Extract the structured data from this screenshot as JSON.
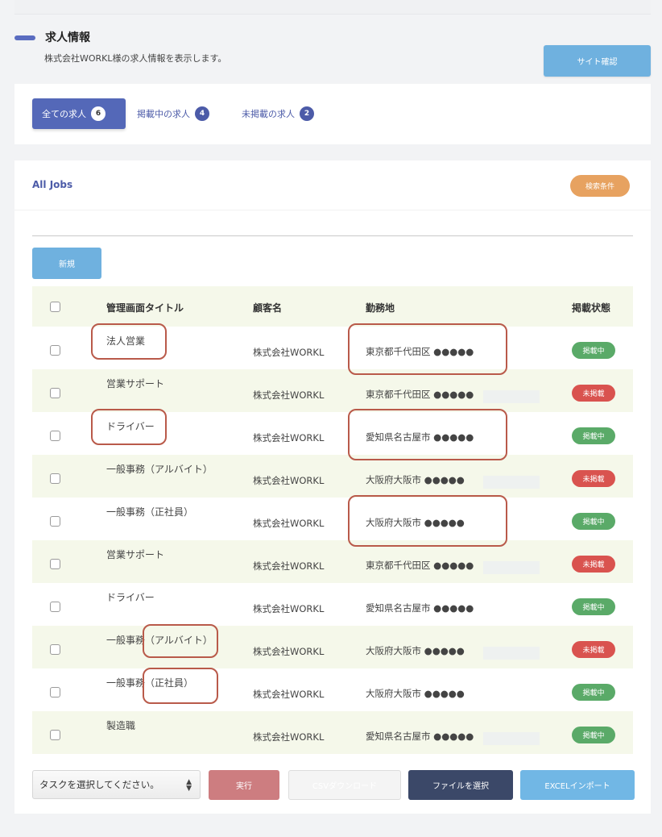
{
  "page": {
    "title": "求人情報",
    "subtitle": "株式会社WORKL様の求人情報を表示します。",
    "site_button": "サイト確認"
  },
  "tabs": [
    {
      "label": "全ての求人",
      "count": "6"
    },
    {
      "label": "掲載中の求人",
      "count": "4"
    },
    {
      "label": "未掲載の求人",
      "count": "2"
    }
  ],
  "jobs_card": {
    "title": "All Jobs",
    "search_button": "検索条件",
    "new_button": "新規"
  },
  "table": {
    "headers": {
      "title": "管理画面タイトル",
      "client": "顧客名",
      "location": "勤務地",
      "status": "掲載状態"
    },
    "rows": [
      {
        "title": "法人営業",
        "client": "株式会社WORKL",
        "location": "東京都千代田区 ●●●●●",
        "status": "掲載中"
      },
      {
        "title": "営業サポート",
        "client": "株式会社WORKL",
        "location": "東京都千代田区 ●●●●●",
        "status": "未掲載"
      },
      {
        "title": "ドライバー",
        "client": "株式会社WORKL",
        "location": "愛知県名古屋市 ●●●●●",
        "status": "掲載中"
      },
      {
        "title": "一般事務（アルバイト）",
        "client": "株式会社WORKL",
        "location": "大阪府大阪市 ●●●●●",
        "status": "未掲載"
      },
      {
        "title": "一般事務（正社員）",
        "client": "株式会社WORKL",
        "location": "大阪府大阪市 ●●●●●",
        "status": "掲載中"
      },
      {
        "title": "営業サポート",
        "client": "株式会社WORKL",
        "location": "東京都千代田区 ●●●●●",
        "status": "未掲載"
      },
      {
        "title": "ドライバー",
        "client": "株式会社WORKL",
        "location": "愛知県名古屋市 ●●●●●",
        "status": "掲載中"
      },
      {
        "title": "一般事務（アルバイト）",
        "client": "株式会社WORKL",
        "location": "大阪府大阪市 ●●●●●",
        "status": "未掲載"
      },
      {
        "title": "一般事務（正社員）",
        "client": "株式会社WORKL",
        "location": "大阪府大阪市 ●●●●●",
        "status": "掲載中"
      },
      {
        "title": "製造職",
        "client": "株式会社WORKL",
        "location": "愛知県名古屋市 ●●●●●",
        "status": "掲載中"
      }
    ]
  },
  "footer": {
    "task_select": "タスクを選択してください。",
    "execute_button": "実行",
    "csv_button": "CSVダウンロード",
    "file_button": "ファイルを選択",
    "excel_button": "EXCELインポート"
  },
  "colors": {
    "primary": "#5468b8",
    "published": "#5aaa68",
    "unpublished": "#d9534f",
    "annotation": "#b95a4a"
  }
}
